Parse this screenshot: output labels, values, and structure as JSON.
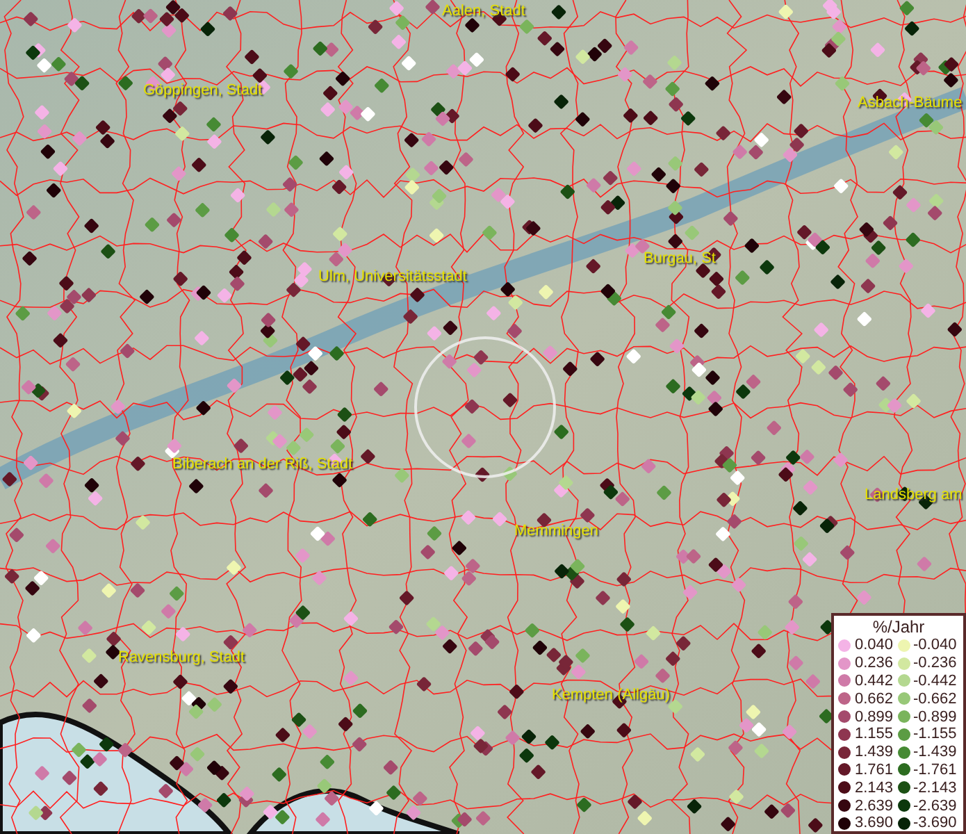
{
  "map": {
    "places": [
      {
        "label": "Aalen, Stadt"
      },
      {
        "label": "Göppingen, Stadt"
      },
      {
        "label": "Asbach-Bäume"
      },
      {
        "label": "Burgau, St"
      },
      {
        "label": "Ulm, Universitätsstadt"
      },
      {
        "label": "Biberach an der Riß, Stadt"
      },
      {
        "label": "Landsberg am"
      },
      {
        "label": "Memmingen"
      },
      {
        "label": "Ravensburg, Stadt"
      },
      {
        "label": "Kempten (Allgäu)"
      }
    ]
  },
  "legend": {
    "title": "%/Jahr",
    "positive": [
      {
        "label": "0.040",
        "color": "#f4b3e6"
      },
      {
        "label": "0.236",
        "color": "#e396c8"
      },
      {
        "label": "0.442",
        "color": "#cf7aa8"
      },
      {
        "label": "0.662",
        "color": "#bd6488"
      },
      {
        "label": "0.899",
        "color": "#a44a6c"
      },
      {
        "label": "1.155",
        "color": "#8e3650"
      },
      {
        "label": "1.439",
        "color": "#782638"
      },
      {
        "label": "1.761",
        "color": "#641828"
      },
      {
        "label": "2.143",
        "color": "#4c0c18"
      },
      {
        "label": "2.639",
        "color": "#360610"
      },
      {
        "label": "3.690",
        "color": "#200208"
      }
    ],
    "negative": [
      {
        "label": "-0.040",
        "color": "#eef5b0"
      },
      {
        "label": "-0.236",
        "color": "#d2e8a0"
      },
      {
        "label": "-0.442",
        "color": "#b4d890"
      },
      {
        "label": "-0.662",
        "color": "#98c878"
      },
      {
        "label": "-0.899",
        "color": "#7ab45c"
      },
      {
        "label": "-1.155",
        "color": "#5c9c44"
      },
      {
        "label": "-1.439",
        "color": "#468a34"
      },
      {
        "label": "-1.761",
        "color": "#2c6c20"
      },
      {
        "label": "-2.143",
        "color": "#1c5014"
      },
      {
        "label": "-2.639",
        "color": "#0c380c"
      },
      {
        "label": "-3.690",
        "color": "#082408"
      }
    ]
  }
}
